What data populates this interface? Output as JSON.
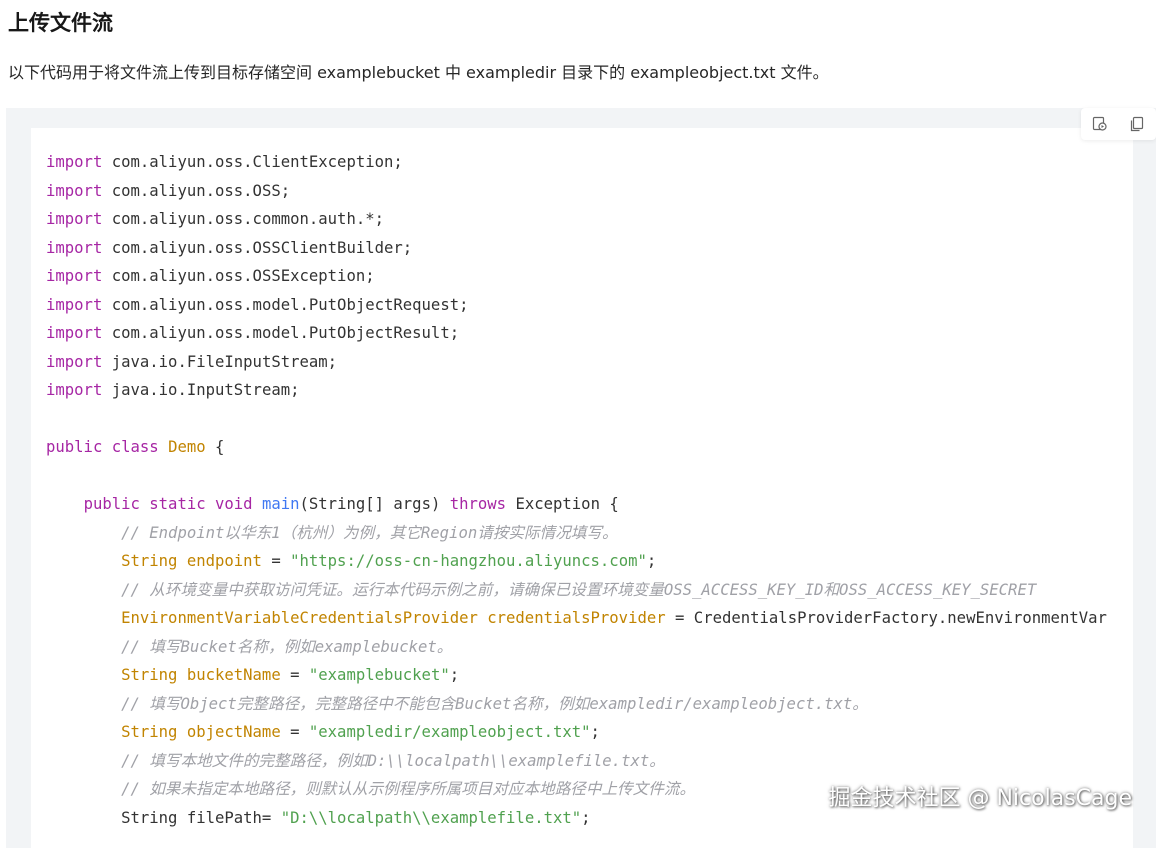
{
  "heading": "上传文件流",
  "description": "以下代码用于将文件流上传到目标存储空间 examplebucket 中 exampledir 目录下的 exampleobject.txt 文件。",
  "toolbar": {
    "run_icon": "run-code-icon",
    "copy_icon": "copy-icon"
  },
  "colors": {
    "keyword": "#a626a4",
    "type": "#c18401",
    "function": "#4078f2",
    "string": "#50a14f",
    "comment": "#a0a1a7",
    "plain": "#333333"
  },
  "code": [
    [
      {
        "t": "import",
        "c": "kw"
      },
      {
        "t": " com.aliyun.oss.ClientException;",
        "c": "pl"
      }
    ],
    [
      {
        "t": "import",
        "c": "kw"
      },
      {
        "t": " com.aliyun.oss.OSS;",
        "c": "pl"
      }
    ],
    [
      {
        "t": "import",
        "c": "kw"
      },
      {
        "t": " com.aliyun.oss.common.auth.*;",
        "c": "pl"
      }
    ],
    [
      {
        "t": "import",
        "c": "kw"
      },
      {
        "t": " com.aliyun.oss.OSSClientBuilder;",
        "c": "pl"
      }
    ],
    [
      {
        "t": "import",
        "c": "kw"
      },
      {
        "t": " com.aliyun.oss.OSSException;",
        "c": "pl"
      }
    ],
    [
      {
        "t": "import",
        "c": "kw"
      },
      {
        "t": " com.aliyun.oss.model.PutObjectRequest;",
        "c": "pl"
      }
    ],
    [
      {
        "t": "import",
        "c": "kw"
      },
      {
        "t": " com.aliyun.oss.model.PutObjectResult;",
        "c": "pl"
      }
    ],
    [
      {
        "t": "import",
        "c": "kw"
      },
      {
        "t": " java.io.FileInputStream;",
        "c": "pl"
      }
    ],
    [
      {
        "t": "import",
        "c": "kw"
      },
      {
        "t": " java.io.InputStream;",
        "c": "pl"
      }
    ],
    [],
    [
      {
        "t": "public class",
        "c": "kw"
      },
      {
        "t": " ",
        "c": "pl"
      },
      {
        "t": "Demo",
        "c": "ty"
      },
      {
        "t": " {",
        "c": "pl"
      }
    ],
    [],
    [
      {
        "t": "    ",
        "c": "pl"
      },
      {
        "t": "public static void",
        "c": "kw"
      },
      {
        "t": " ",
        "c": "pl"
      },
      {
        "t": "main",
        "c": "fn"
      },
      {
        "t": "(String[] args) ",
        "c": "pl"
      },
      {
        "t": "throws",
        "c": "kw"
      },
      {
        "t": " Exception {",
        "c": "pl"
      }
    ],
    [
      {
        "t": "        ",
        "c": "pl"
      },
      {
        "t": "// Endpoint以华东1（杭州）为例，其它Region请按实际情况填写。",
        "c": "cm"
      }
    ],
    [
      {
        "t": "        ",
        "c": "pl"
      },
      {
        "t": "String endpoint",
        "c": "ty"
      },
      {
        "t": " = ",
        "c": "pl"
      },
      {
        "t": "\"https://oss-cn-hangzhou.aliyuncs.com\"",
        "c": "str"
      },
      {
        "t": ";",
        "c": "pl"
      }
    ],
    [
      {
        "t": "        ",
        "c": "pl"
      },
      {
        "t": "// 从环境变量中获取访问凭证。运行本代码示例之前，请确保已设置环境变量OSS_ACCESS_KEY_ID和OSS_ACCESS_KEY_SECRET",
        "c": "cm"
      }
    ],
    [
      {
        "t": "        ",
        "c": "pl"
      },
      {
        "t": "EnvironmentVariableCredentialsProvider credentialsProvider",
        "c": "ty"
      },
      {
        "t": " = CredentialsProviderFactory.newEnvironmentVar",
        "c": "pl"
      }
    ],
    [
      {
        "t": "        ",
        "c": "pl"
      },
      {
        "t": "// 填写Bucket名称，例如examplebucket。",
        "c": "cm"
      }
    ],
    [
      {
        "t": "        ",
        "c": "pl"
      },
      {
        "t": "String bucketName",
        "c": "ty"
      },
      {
        "t": " = ",
        "c": "pl"
      },
      {
        "t": "\"examplebucket\"",
        "c": "str"
      },
      {
        "t": ";",
        "c": "pl"
      }
    ],
    [
      {
        "t": "        ",
        "c": "pl"
      },
      {
        "t": "// 填写Object完整路径，完整路径中不能包含Bucket名称，例如exampledir/exampleobject.txt。",
        "c": "cm"
      }
    ],
    [
      {
        "t": "        ",
        "c": "pl"
      },
      {
        "t": "String objectName",
        "c": "ty"
      },
      {
        "t": " = ",
        "c": "pl"
      },
      {
        "t": "\"exampledir/exampleobject.txt\"",
        "c": "str"
      },
      {
        "t": ";",
        "c": "pl"
      }
    ],
    [
      {
        "t": "        ",
        "c": "pl"
      },
      {
        "t": "// 填写本地文件的完整路径，例如D:\\\\localpath\\\\examplefile.txt。",
        "c": "cm"
      }
    ],
    [
      {
        "t": "        ",
        "c": "pl"
      },
      {
        "t": "// 如果未指定本地路径，则默认从示例程序所属项目对应本地路径中上传文件流。",
        "c": "cm"
      }
    ],
    [
      {
        "t": "        String filePath= ",
        "c": "pl"
      },
      {
        "t": "\"D:\\\\localpath\\\\examplefile.txt\"",
        "c": "str"
      },
      {
        "t": ";",
        "c": "pl"
      }
    ]
  ],
  "watermark": "掘金技术社区 @ NicolasCage"
}
